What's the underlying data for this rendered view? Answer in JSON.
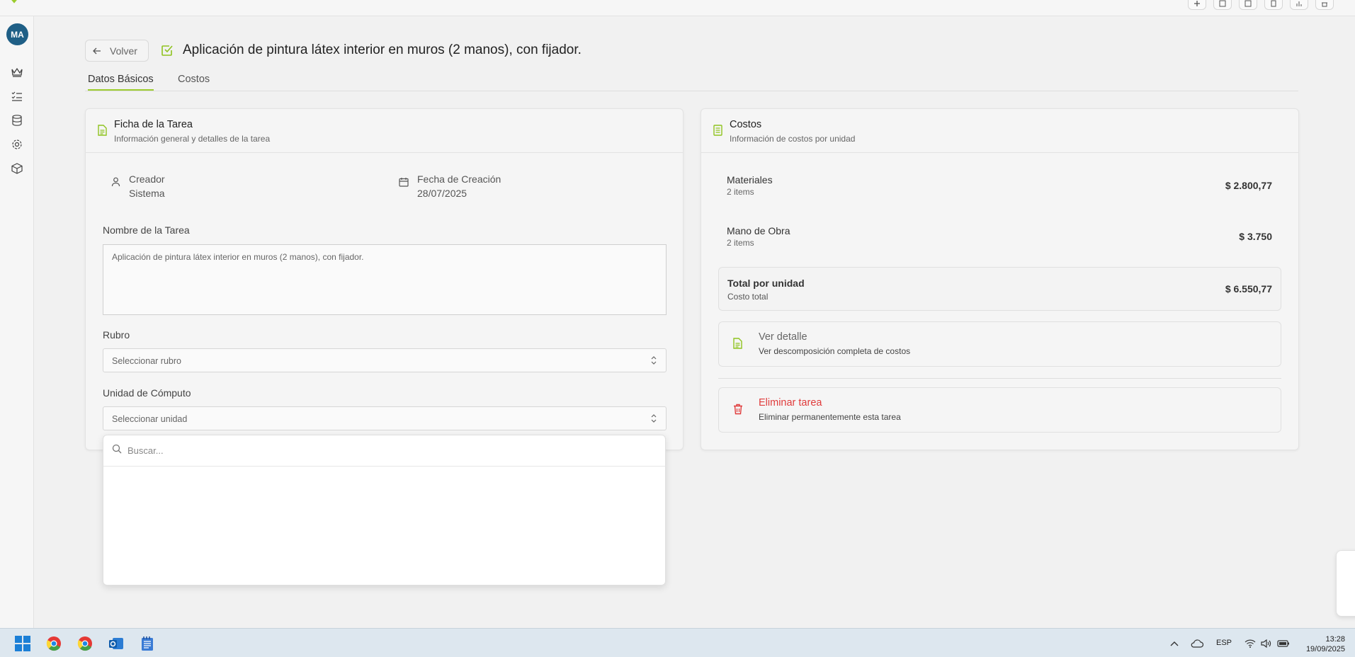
{
  "header": {
    "back_label": "Volver",
    "title": "Aplicación de pintura látex interior en muros (2 manos), con fijador."
  },
  "sidebar": {
    "avatar_initials": "MA",
    "items": [
      "crown-icon",
      "list-icon",
      "database-icon",
      "gear-icon",
      "box-icon"
    ]
  },
  "tabs": [
    {
      "label": "Datos Básicos",
      "active": true
    },
    {
      "label": "Costos",
      "active": false
    }
  ],
  "task_card": {
    "title": "Ficha de la Tarea",
    "subtitle": "Información general y detalles de la tarea",
    "creator_label": "Creador",
    "creator_value": "Sistema",
    "date_label": "Fecha de Creación",
    "date_value": "28/07/2025",
    "name_label": "Nombre de la Tarea",
    "name_value": "Aplicación de pintura látex interior en muros (2 manos), con fijador.",
    "rubro_label": "Rubro",
    "rubro_placeholder": "Seleccionar rubro",
    "unit_label": "Unidad de Cómputo",
    "unit_placeholder": "Seleccionar unidad",
    "search_placeholder": "Buscar..."
  },
  "costs_card": {
    "title": "Costos",
    "subtitle": "Información de costos por unidad",
    "rows": [
      {
        "label": "Materiales",
        "count": "2 items",
        "value": "$ 2.800,77"
      },
      {
        "label": "Mano de Obra",
        "count": "2 items",
        "value": "$ 3.750"
      }
    ],
    "total_label": "Total por unidad",
    "total_sub": "Costo total",
    "total_value": "$ 6.550,77",
    "detail_title": "Ver detalle",
    "detail_sub": "Ver descomposición completa de costos",
    "delete_title": "Eliminar tarea",
    "delete_sub": "Eliminar permanentemente esta tarea"
  },
  "taskbar": {
    "language": "ESP",
    "time": "13:28",
    "date": "19/09/2025"
  },
  "colors": {
    "accent": "#9ccc2e",
    "danger": "#e03b3b",
    "avatar": "#1f5f86"
  }
}
